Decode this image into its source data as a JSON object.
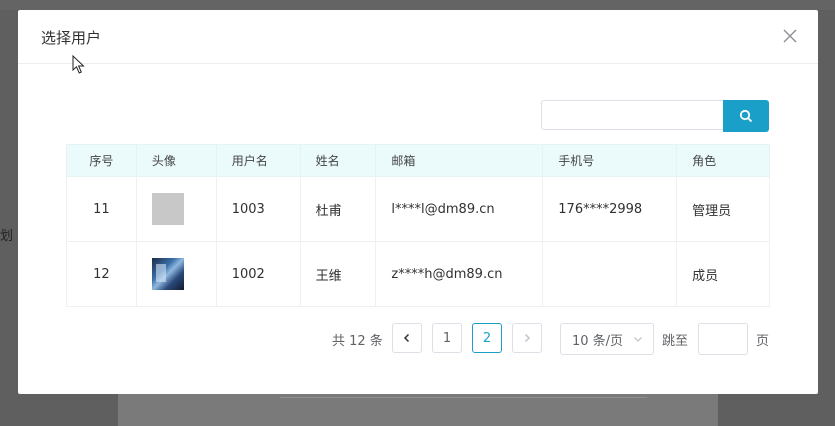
{
  "background": {
    "side_text": "划"
  },
  "dialog": {
    "title": "选择用户"
  },
  "search": {
    "placeholder": "",
    "value": ""
  },
  "table": {
    "headers": [
      "序号",
      "头像",
      "用户名",
      "姓名",
      "邮箱",
      "手机号",
      "角色"
    ],
    "rows": [
      {
        "index": "11",
        "avatar": "placeholder",
        "username": "1003",
        "name": "杜甫",
        "email": "l****l@dm89.cn",
        "phone": "176****2998",
        "role": "管理员"
      },
      {
        "index": "12",
        "avatar": "photo",
        "username": "1002",
        "name": "王维",
        "email": "z****h@dm89.cn",
        "phone": "",
        "role": "成员"
      }
    ]
  },
  "pagination": {
    "total_text": "共 12 条",
    "pages": [
      "1",
      "2"
    ],
    "current_page": "2",
    "page_size": "10 条/页",
    "jump_label": "跳至",
    "jump_value": "",
    "page_suffix": "页"
  },
  "colors": {
    "accent": "#1aa0c8",
    "header_bg": "#ebfbfc"
  }
}
